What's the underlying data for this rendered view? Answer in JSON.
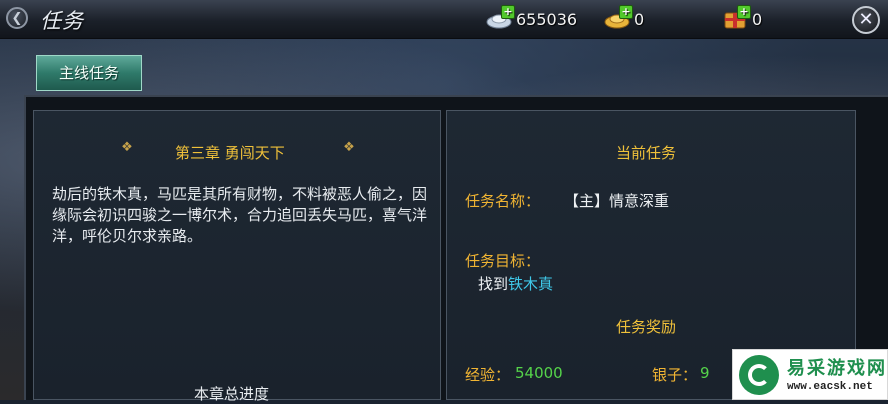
{
  "header": {
    "title": "任务",
    "currencies": [
      {
        "icon": "silver-ingot-icon",
        "value": "655036"
      },
      {
        "icon": "gold-ingot-icon",
        "value": "0"
      },
      {
        "icon": "gift-ticket-icon",
        "value": "0"
      }
    ]
  },
  "tabs": [
    {
      "label": "主线任务"
    }
  ],
  "chapter": {
    "title": "第三章 勇闯天下",
    "description": "劫后的铁木真，马匹是其所有财物，不料被恶人偷之，因缘际会初识四骏之一博尔术，合力追回丢失马匹，喜气洋洋，呼伦贝尔求亲路。",
    "progress_label": "本章总进度"
  },
  "current_task": {
    "section_title": "当前任务",
    "name_label": "任务名称：",
    "name_value": "【主】情意深重",
    "goal_label": "任务目标：",
    "goal_prefix": "找到",
    "goal_target": "铁木真",
    "reward_title": "任务奖励",
    "exp_label": "经验：",
    "exp_value": "54000",
    "silver_label": "银子：",
    "silver_value": "9"
  },
  "watermark": {
    "name": "易采游戏网",
    "url": "www.eacsk.net"
  },
  "colors": {
    "gold_text": "#f0c13a",
    "orange_label": "#f0b433",
    "cyan_target": "#3fc8e8",
    "green_value": "#55d44a",
    "tab_green": "#2f7a6a"
  }
}
